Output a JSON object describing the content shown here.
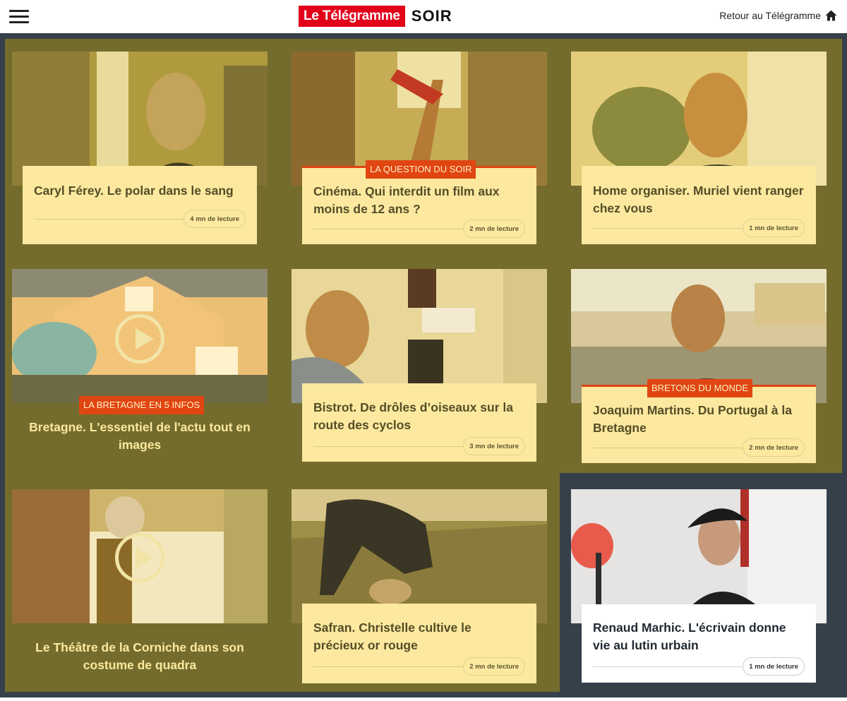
{
  "header": {
    "logo_main": "Le Télégramme",
    "logo_soir": "SOIR",
    "back_link": "Retour au Télégramme",
    "menu_icon": "hamburger-menu-icon",
    "home_icon": "home-icon"
  },
  "colors": {
    "brand_red": "#e2001a",
    "olive_bg": "#746c2d",
    "navy_bg": "#35404b",
    "card_yellow": "#fce99f",
    "tag_orange": "#e04512"
  },
  "cards": [
    {
      "title": "Caryl Férey. Le polar dans le sang",
      "read_time": "4 mn de lecture",
      "tag": ""
    },
    {
      "title": "Cinéma. Qui interdit un film aux moins de 12 ans ?",
      "read_time": "2 mn de lecture",
      "tag": "LA QUESTION DU SOIR"
    },
    {
      "title": "Home organiser. Muriel vient ranger chez vous",
      "read_time": "1 mn de lecture",
      "tag": ""
    },
    {
      "title": "Bretagne. L'essentiel de l'actu tout en images",
      "read_time": "",
      "tag": "LA BRETAGNE EN 5 INFOS",
      "video": true
    },
    {
      "title": "Bistrot. De drôles d’oiseaux sur la route des cyclos",
      "read_time": "3 mn de lecture",
      "tag": ""
    },
    {
      "title": "Joaquim Martins. Du Portugal à la Bretagne",
      "read_time": "2 mn de lecture",
      "tag": "BRETONS DU MONDE"
    },
    {
      "title": "Le Théâtre de la Corniche dans son costume de quadra",
      "read_time": "",
      "tag": "",
      "video": true
    },
    {
      "title": "Safran. Christelle cultive le précieux or rouge",
      "read_time": "2 mn de lecture",
      "tag": ""
    },
    {
      "title": "Renaud Marhic. L'écrivain donne vie au lutin urbain",
      "read_time": "1 mn de lecture",
      "tag": ""
    }
  ]
}
